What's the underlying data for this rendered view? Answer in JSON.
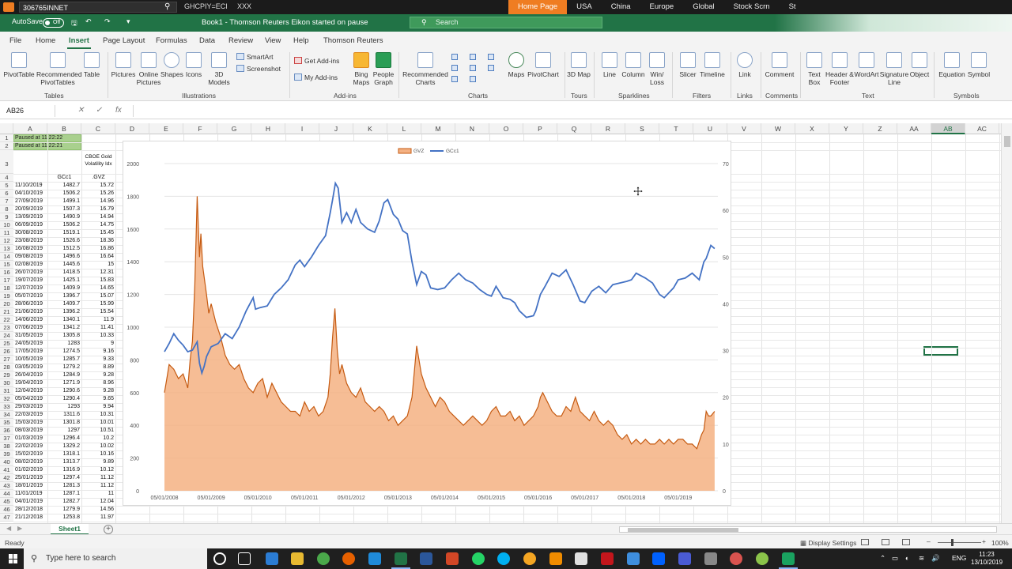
{
  "eikon": {
    "command_value": "306765INNET",
    "quote_1": "GHCPIY=ECI",
    "quote_2": "XXX",
    "tabs": [
      "Home Page",
      "USA",
      "China",
      "Europe",
      "Global",
      "Stock Scrn",
      "St"
    ]
  },
  "titlebar": {
    "autosave": "AutoSave",
    "autosave_state": "Off",
    "title": "Book1 - Thomson Reuters Eikon started on pause",
    "search_placeholder": "Search"
  },
  "menu": [
    "File",
    "Home",
    "Insert",
    "Page Layout",
    "Formulas",
    "Data",
    "Review",
    "View",
    "Help",
    "Thomson Reuters"
  ],
  "ribbon": {
    "pivottable": "PivotTable",
    "recommended_pivot": "Recommended PivotTables",
    "table": "Table",
    "tables_group": "Tables",
    "pictures": "Pictures",
    "online_pictures": "Online Pictures",
    "shapes": "Shapes",
    "icons": "Icons",
    "models_3d": "3D Models",
    "smartart": "SmartArt",
    "screenshot": "Screenshot",
    "illustrations_group": "Illustrations",
    "get_addins": "Get Add-ins",
    "my_addins": "My Add-ins",
    "bing_maps": "Bing Maps",
    "people_graph": "People Graph",
    "addins_group": "Add-ins",
    "recommended_charts": "Recommended Charts",
    "maps": "Maps",
    "pivotchart": "PivotChart",
    "charts_group": "Charts",
    "map_3d": "3D Map",
    "tours_group": "Tours",
    "line": "Line",
    "column": "Column",
    "win_loss": "Win/ Loss",
    "sparklines_group": "Sparklines",
    "slicer": "Slicer",
    "timeline": "Timeline",
    "filters_group": "Filters",
    "link": "Link",
    "links_group": "Links",
    "comment": "Comment",
    "comments_group": "Comments",
    "text_box": "Text Box",
    "header_footer": "Header & Footer",
    "wordart": "WordArt",
    "signature_line": "Signature Line",
    "object": "Object",
    "text_group": "Text",
    "equation": "Equation",
    "symbol": "Symbol",
    "symbols_group": "Symbols"
  },
  "formula_bar": {
    "name_box": "AB26",
    "fx": "fx",
    "value": ""
  },
  "columns": [
    "A",
    "B",
    "C",
    "D",
    "E",
    "F",
    "G",
    "H",
    "I",
    "J",
    "K",
    "L",
    "M",
    "N",
    "O",
    "P",
    "Q",
    "R",
    "S",
    "T",
    "U",
    "V",
    "W",
    "X",
    "Y",
    "Z",
    "AA",
    "AB",
    "AC"
  ],
  "selected_column": "AB",
  "rows": [
    "1",
    "2",
    "3",
    "4",
    "5",
    "6",
    "7",
    "8",
    "9",
    "10",
    "11",
    "12",
    "13",
    "14",
    "15",
    "16",
    "17",
    "18",
    "19",
    "20",
    "21",
    "22",
    "23",
    "24",
    "25",
    "26",
    "27",
    "28",
    "29",
    "30",
    "31",
    "32",
    "33",
    "34",
    "35",
    "36",
    "37",
    "38",
    "39",
    "40",
    "41",
    "42",
    "43",
    "44",
    "45",
    "46",
    "47"
  ],
  "sheet": {
    "paused_1": "Paused at 11:22:22",
    "paused_2": "Paused at 11:22:21",
    "c3_header": "CBOE Gold Volatility Idx",
    "b4": "GCc1",
    "c4": ".GVZ",
    "data": [
      [
        "11/10/2019",
        "1482.7",
        "15.72"
      ],
      [
        "04/10/2019",
        "1506.2",
        "15.26"
      ],
      [
        "27/09/2019",
        "1499.1",
        "14.96"
      ],
      [
        "20/09/2019",
        "1507.3",
        "16.79"
      ],
      [
        "13/09/2019",
        "1490.9",
        "14.94"
      ],
      [
        "06/09/2019",
        "1506.2",
        "14.75"
      ],
      [
        "30/08/2019",
        "1519.1",
        "15.45"
      ],
      [
        "23/08/2019",
        "1526.6",
        "18.36"
      ],
      [
        "16/08/2019",
        "1512.5",
        "16.86"
      ],
      [
        "09/08/2019",
        "1496.6",
        "16.64"
      ],
      [
        "02/08/2019",
        "1445.6",
        "15"
      ],
      [
        "26/07/2019",
        "1418.5",
        "12.31"
      ],
      [
        "19/07/2019",
        "1425.1",
        "15.83"
      ],
      [
        "12/07/2019",
        "1409.9",
        "14.65"
      ],
      [
        "05/07/2019",
        "1396.7",
        "15.07"
      ],
      [
        "28/06/2019",
        "1409.7",
        "15.99"
      ],
      [
        "21/06/2019",
        "1396.2",
        "15.54"
      ],
      [
        "14/06/2019",
        "1340.1",
        "11.9"
      ],
      [
        "07/06/2019",
        "1341.2",
        "11.41"
      ],
      [
        "31/05/2019",
        "1305.8",
        "10.33"
      ],
      [
        "24/05/2019",
        "1283",
        "9"
      ],
      [
        "17/05/2019",
        "1274.5",
        "9.16"
      ],
      [
        "10/05/2019",
        "1285.7",
        "9.33"
      ],
      [
        "03/05/2019",
        "1279.2",
        "8.89"
      ],
      [
        "26/04/2019",
        "1284.9",
        "9.28"
      ],
      [
        "19/04/2019",
        "1271.9",
        "8.96"
      ],
      [
        "12/04/2019",
        "1290.6",
        "9.28"
      ],
      [
        "05/04/2019",
        "1290.4",
        "9.65"
      ],
      [
        "29/03/2019",
        "1293",
        "9.94"
      ],
      [
        "22/03/2019",
        "1311.6",
        "10.31"
      ],
      [
        "15/03/2019",
        "1301.8",
        "10.01"
      ],
      [
        "08/03/2019",
        "1297",
        "10.51"
      ],
      [
        "01/03/2019",
        "1296.4",
        "10.2"
      ],
      [
        "22/02/2019",
        "1329.2",
        "10.02"
      ],
      [
        "15/02/2019",
        "1318.1",
        "10.16"
      ],
      [
        "08/02/2019",
        "1313.7",
        "9.89"
      ],
      [
        "01/02/2019",
        "1316.9",
        "10.12"
      ],
      [
        "25/01/2019",
        "1297.4",
        "11.12"
      ],
      [
        "18/01/2019",
        "1281.3",
        "11.12"
      ],
      [
        "11/01/2019",
        "1287.1",
        "11"
      ],
      [
        "04/01/2019",
        "1282.7",
        "12.04"
      ],
      [
        "28/12/2018",
        "1279.9",
        "14.56"
      ],
      [
        "21/12/2018",
        "1253.8",
        "11.97"
      ]
    ]
  },
  "chart_data": {
    "type": "area",
    "legend": [
      "GVZ",
      "GCc1"
    ],
    "legend_position": "top",
    "x_ticks": [
      "05/01/2008",
      "05/01/2009",
      "05/01/2010",
      "05/01/2011",
      "05/01/2012",
      "05/01/2013",
      "05/01/2014",
      "05/01/2015",
      "05/01/2016",
      "05/01/2017",
      "05/01/2018",
      "05/01/2019"
    ],
    "y_left_ticks": [
      "0",
      "200",
      "400",
      "600",
      "800",
      "1000",
      "1200",
      "1400",
      "1600",
      "1800",
      "2000"
    ],
    "y_right_ticks": [
      "0",
      "10",
      "20",
      "30",
      "40",
      "50",
      "60",
      "70"
    ],
    "y_left_range": [
      0,
      2000
    ],
    "y_right_range": [
      0,
      70
    ],
    "gridlines": true,
    "series": [
      {
        "name": "GCc1",
        "kind": "line",
        "axis": "left",
        "color": "#4472c4",
        "x": [
          2008.0,
          2008.1,
          2008.2,
          2008.3,
          2008.4,
          2008.5,
          2008.6,
          2008.7,
          2008.75,
          2008.8,
          2008.85,
          2008.9,
          2009.0,
          2009.15,
          2009.3,
          2009.45,
          2009.6,
          2009.75,
          2009.9,
          2009.95,
          2010.05,
          2010.2,
          2010.35,
          2010.5,
          2010.65,
          2010.8,
          2010.9,
          2011.0,
          2011.15,
          2011.3,
          2011.45,
          2011.55,
          2011.6,
          2011.66,
          2011.72,
          2011.8,
          2011.9,
          2012.0,
          2012.1,
          2012.2,
          2012.35,
          2012.5,
          2012.6,
          2012.7,
          2012.78,
          2012.9,
          2013.0,
          2013.1,
          2013.2,
          2013.3,
          2013.4,
          2013.5,
          2013.6,
          2013.7,
          2013.85,
          2014.0,
          2014.15,
          2014.3,
          2014.45,
          2014.6,
          2014.75,
          2014.9,
          2015.0,
          2015.1,
          2015.25,
          2015.4,
          2015.5,
          2015.6,
          2015.75,
          2015.9,
          2015.95,
          2016.05,
          2016.15,
          2016.3,
          2016.45,
          2016.6,
          2016.75,
          2016.9,
          2017.0,
          2017.15,
          2017.3,
          2017.45,
          2017.6,
          2017.75,
          2017.9,
          2018.0,
          2018.1,
          2018.3,
          2018.45,
          2018.6,
          2018.7,
          2018.8,
          2018.9,
          2019.0,
          2019.15,
          2019.3,
          2019.45,
          2019.55,
          2019.6,
          2019.7,
          2019.78
        ],
        "values": [
          850,
          900,
          960,
          920,
          890,
          850,
          860,
          910,
          780,
          720,
          760,
          820,
          880,
          900,
          960,
          930,
          1000,
          1100,
          1180,
          1110,
          1120,
          1130,
          1200,
          1240,
          1290,
          1380,
          1410,
          1370,
          1430,
          1500,
          1560,
          1700,
          1780,
          1880,
          1850,
          1640,
          1700,
          1640,
          1720,
          1640,
          1600,
          1580,
          1650,
          1760,
          1780,
          1690,
          1660,
          1590,
          1570,
          1400,
          1260,
          1340,
          1320,
          1240,
          1230,
          1240,
          1290,
          1330,
          1290,
          1270,
          1230,
          1200,
          1190,
          1250,
          1180,
          1170,
          1150,
          1100,
          1060,
          1070,
          1100,
          1200,
          1250,
          1330,
          1310,
          1350,
          1260,
          1160,
          1150,
          1220,
          1250,
          1210,
          1260,
          1270,
          1280,
          1290,
          1330,
          1300,
          1270,
          1200,
          1180,
          1210,
          1240,
          1290,
          1300,
          1330,
          1290,
          1400,
          1420,
          1500,
          1480
        ]
      },
      {
        "name": "GVZ",
        "kind": "area",
        "axis": "right",
        "color": "#c55a11",
        "fill": "#f4b183",
        "x": [
          2008.0,
          2008.05,
          2008.1,
          2008.2,
          2008.3,
          2008.4,
          2008.5,
          2008.55,
          2008.6,
          2008.65,
          2008.7,
          2008.75,
          2008.78,
          2008.82,
          2008.86,
          2008.9,
          2008.95,
          2009.0,
          2009.1,
          2009.2,
          2009.3,
          2009.4,
          2009.5,
          2009.6,
          2009.7,
          2009.8,
          2009.9,
          2010.0,
          2010.1,
          2010.2,
          2010.3,
          2010.4,
          2010.5,
          2010.6,
          2010.7,
          2010.8,
          2010.9,
          2011.0,
          2011.1,
          2011.2,
          2011.3,
          2011.4,
          2011.5,
          2011.55,
          2011.6,
          2011.65,
          2011.7,
          2011.75,
          2011.8,
          2011.9,
          2012.0,
          2012.1,
          2012.2,
          2012.3,
          2012.4,
          2012.5,
          2012.6,
          2012.7,
          2012.8,
          2012.9,
          2013.0,
          2013.1,
          2013.2,
          2013.3,
          2013.4,
          2013.5,
          2013.6,
          2013.7,
          2013.8,
          2013.9,
          2014.0,
          2014.1,
          2014.2,
          2014.3,
          2014.4,
          2014.5,
          2014.6,
          2014.7,
          2014.8,
          2014.9,
          2015.0,
          2015.1,
          2015.2,
          2015.3,
          2015.4,
          2015.5,
          2015.6,
          2015.7,
          2015.8,
          2015.9,
          2016.0,
          2016.05,
          2016.1,
          2016.2,
          2016.3,
          2016.4,
          2016.5,
          2016.6,
          2016.7,
          2016.8,
          2016.9,
          2017.0,
          2017.1,
          2017.2,
          2017.3,
          2017.4,
          2017.5,
          2017.6,
          2017.7,
          2017.8,
          2017.9,
          2018.0,
          2018.1,
          2018.2,
          2018.3,
          2018.4,
          2018.5,
          2018.6,
          2018.7,
          2018.8,
          2018.9,
          2019.0,
          2019.1,
          2019.2,
          2019.3,
          2019.4,
          2019.5,
          2019.55,
          2019.6,
          2019.65,
          2019.7,
          2019.78
        ],
        "values": [
          21,
          24,
          27,
          26,
          24,
          25,
          22,
          28,
          32,
          44,
          63,
          50,
          55,
          48,
          45,
          42,
          38,
          40,
          36,
          33,
          29,
          27,
          26,
          27,
          24,
          22,
          21,
          23,
          24,
          20,
          23,
          21,
          19,
          18,
          17,
          17,
          16,
          19,
          17,
          18,
          16,
          17,
          20,
          25,
          33,
          39,
          30,
          25,
          27,
          23,
          21,
          20,
          22,
          19,
          18,
          17,
          18,
          17,
          15,
          16,
          14,
          15,
          16,
          20,
          31,
          25,
          22,
          20,
          18,
          20,
          19,
          17,
          16,
          15,
          14,
          15,
          16,
          15,
          14,
          15,
          17,
          18,
          16,
          16,
          17,
          15,
          16,
          14,
          15,
          16,
          18,
          20,
          21,
          19,
          17,
          16,
          16,
          18,
          17,
          20,
          17,
          16,
          15,
          17,
          15,
          14,
          15,
          14,
          12,
          11,
          12,
          10,
          11,
          10,
          11,
          10,
          10,
          11,
          10,
          11,
          10,
          11,
          11,
          10,
          10,
          9,
          12,
          13,
          17,
          16,
          16,
          17
        ]
      }
    ]
  }
}
